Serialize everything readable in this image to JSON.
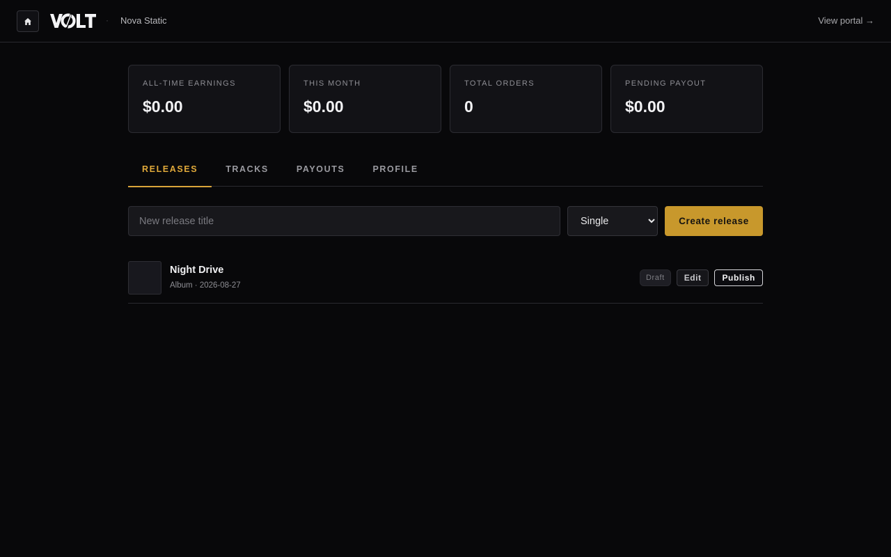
{
  "header": {
    "home_icon": "home-icon",
    "logo_text": "VOLT",
    "separator": "·",
    "artist_name": "Nova Static",
    "portal_link": "View portal →"
  },
  "stats": [
    {
      "label": "ALL-TIME EARNINGS",
      "value": "$0.00"
    },
    {
      "label": "THIS MONTH",
      "value": "$0.00"
    },
    {
      "label": "TOTAL ORDERS",
      "value": "0"
    },
    {
      "label": "PENDING PAYOUT",
      "value": "$0.00"
    }
  ],
  "tabs": [
    {
      "label": "RELEASES",
      "active": true
    },
    {
      "label": "TRACKS",
      "active": false
    },
    {
      "label": "PAYOUTS",
      "active": false
    },
    {
      "label": "PROFILE",
      "active": false
    }
  ],
  "create": {
    "title_placeholder": "New release title",
    "title_value": "",
    "type_selected": "Single",
    "create_label": "Create release"
  },
  "releases": [
    {
      "title": "Night Drive",
      "meta": "Album · 2026-08-27",
      "status": "Draft",
      "edit_label": "Edit",
      "publish_label": "Publish"
    }
  ],
  "colors": {
    "accent": "#d9a43a",
    "button_bg": "#c8982c",
    "background": "#08080a",
    "card": "#121216"
  }
}
